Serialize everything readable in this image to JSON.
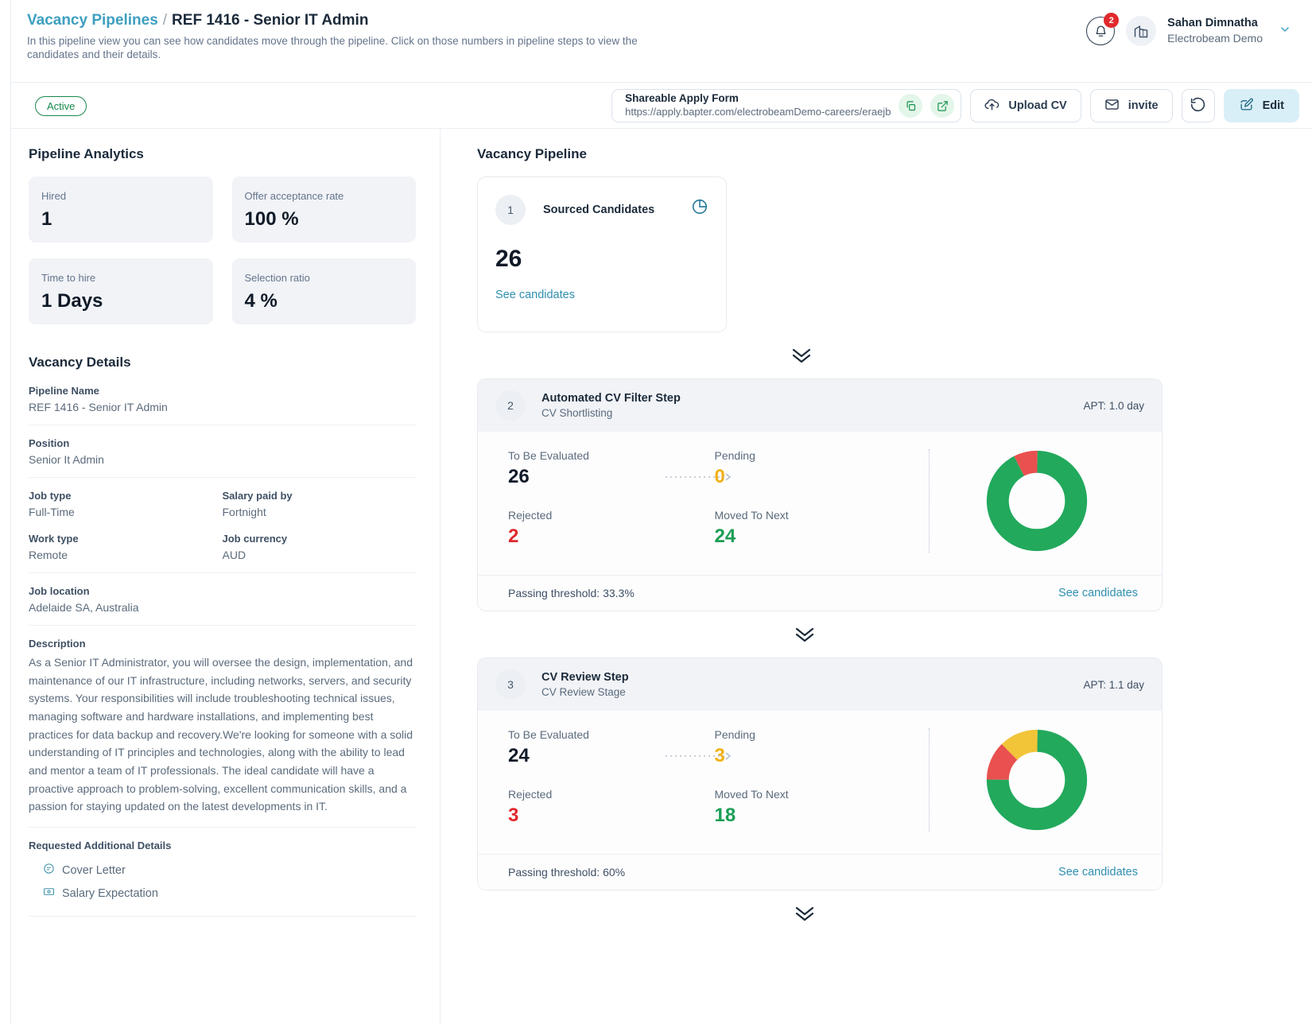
{
  "header": {
    "breadcrumb_parent": "Vacancy Pipelines",
    "breadcrumb_sep": "/",
    "breadcrumb_current": "REF 1416 - Senior IT Admin",
    "subtitle": "In this pipeline view you can see how candidates move through the pipeline. Click on those numbers in pipeline steps to view the candidates and their details.",
    "notification_count": "2",
    "user_name": "Sahan Dimnatha",
    "user_org": "Electrobeam Demo"
  },
  "toolbar": {
    "status": "Active",
    "share_label": "Shareable Apply Form",
    "share_url": "https://apply.bapter.com/electrobeamDemo-careers/eraejb",
    "upload_cv": "Upload CV",
    "invite": "invite",
    "edit": "Edit"
  },
  "analytics": {
    "title": "Pipeline Analytics",
    "cards": [
      {
        "label": "Hired",
        "value": "1"
      },
      {
        "label": "Offer acceptance rate",
        "value": "100 %"
      },
      {
        "label": "Time to hire",
        "value": "1 Days"
      },
      {
        "label": "Selection ratio",
        "value": "4 %"
      }
    ]
  },
  "vacancy_details": {
    "title": "Vacancy Details",
    "pipeline_name_label": "Pipeline Name",
    "pipeline_name_value": "REF 1416 - Senior IT Admin",
    "position_label": "Position",
    "position_value": "Senior It Admin",
    "job_type_label": "Job type",
    "job_type_value": "Full-Time",
    "salary_paid_by_label": "Salary paid by",
    "salary_paid_by_value": "Fortnight",
    "work_type_label": "Work type",
    "work_type_value": "Remote",
    "job_currency_label": "Job currency",
    "job_currency_value": "AUD",
    "job_location_label": "Job location",
    "job_location_value": "Adelaide SA, Australia",
    "description_label": "Description",
    "description_value": "As a Senior IT Administrator, you will oversee the design, implementation, and maintenance of our IT infrastructure, including networks, servers, and security systems. Your responsibilities will include troubleshooting technical issues, managing software and hardware installations, and implementing best practices for data backup and recovery.We're looking for someone with a solid understanding of IT principles and technologies, along with the ability to lead and mentor a team of IT professionals. The ideal candidate will have a proactive approach to problem-solving, excellent communication skills, and a passion for staying updated on the latest developments in IT.",
    "requested_label": "Requested Additional Details",
    "requested_items": [
      {
        "label": "Cover Letter",
        "icon": "document-icon"
      },
      {
        "label": "Salary Expectation",
        "icon": "money-icon"
      }
    ]
  },
  "pipeline": {
    "title": "Vacancy Pipeline",
    "sourced": {
      "step": "1",
      "name": "Sourced Candidates",
      "count": "26",
      "see_candidates": "See candidates"
    },
    "steps": [
      {
        "step": "2",
        "name": "Automated CV Filter Step",
        "subname": "CV Shortlisting",
        "apt": "APT: 1.0 day",
        "to_be_evaluated_label": "To Be Evaluated",
        "to_be_evaluated": "26",
        "pending_label": "Pending",
        "pending": "0",
        "rejected_label": "Rejected",
        "rejected": "2",
        "moved_label": "Moved To Next",
        "moved": "24",
        "threshold": "Passing threshold: 33.3%",
        "see_candidates": "See candidates"
      },
      {
        "step": "3",
        "name": "CV Review Step",
        "subname": "CV Review Stage",
        "apt": "APT: 1.1 day",
        "to_be_evaluated_label": "To Be Evaluated",
        "to_be_evaluated": "24",
        "pending_label": "Pending",
        "pending": "3",
        "rejected_label": "Rejected",
        "rejected": "3",
        "moved_label": "Moved To Next",
        "moved": "18",
        "threshold": "Passing threshold: 60%",
        "see_candidates": "See candidates"
      }
    ]
  },
  "colors": {
    "green": "#22a95c",
    "red": "#e8514f",
    "amber": "#f2c438",
    "accent": "#2f8fb0"
  },
  "chart_data": [
    {
      "type": "pie",
      "title": "Automated CV Filter Step outcome",
      "labels": [
        "Moved To Next",
        "Rejected"
      ],
      "values": [
        24,
        2
      ],
      "colors": [
        "#22a95c",
        "#e8514f"
      ],
      "legend": "none"
    },
    {
      "type": "pie",
      "title": "CV Review Step outcome",
      "labels": [
        "Moved To Next",
        "Rejected",
        "Pending"
      ],
      "values": [
        18,
        3,
        3
      ],
      "colors": [
        "#22a95c",
        "#e8514f",
        "#f2c438"
      ],
      "legend": "none"
    }
  ]
}
